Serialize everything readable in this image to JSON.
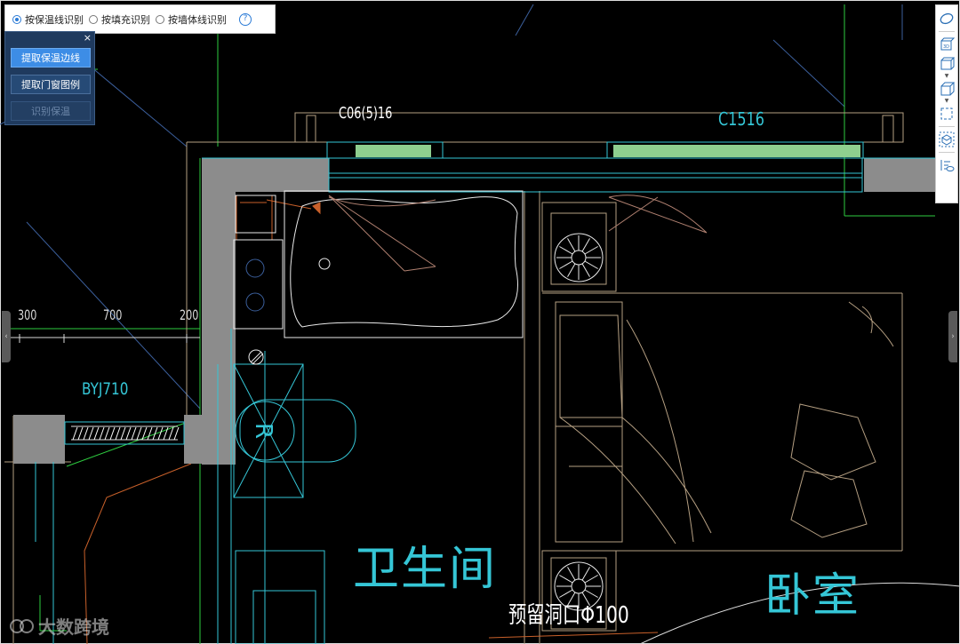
{
  "mode_bar": {
    "options": [
      {
        "label": "按保温线识别",
        "selected": true
      },
      {
        "label": "按填充识别",
        "selected": false
      },
      {
        "label": "按墙体线识别",
        "selected": false
      }
    ],
    "help_glyph": "?"
  },
  "panel": {
    "close_glyph": "×",
    "buttons": {
      "extract_boundary": "提取保温边线",
      "extract_legend": "提取门窗图例",
      "recognize": "识别保温"
    }
  },
  "drawing": {
    "window_tag_1": "C06(5)16",
    "window_tag_2": "C1516",
    "wall_tag": "BYJ710",
    "dim_1": "300",
    "dim_2": "700",
    "dim_3": "200",
    "room_bathroom": "卫生间",
    "room_bedroom": "卧室",
    "note_opening": "预留洞口Φ100",
    "letter_r": "R"
  },
  "side_tabs": {
    "left": "‹",
    "right": "›"
  },
  "watermark": {
    "text": "大数跨境"
  },
  "colors": {
    "canvas": "#000000",
    "wall_fill": "#8c8c8c",
    "cyan": "#35c6d6",
    "green": "#2ecc40",
    "window_green": "#8fcf8f",
    "tan": "#b59f82",
    "panel_bg": "#1f3a5e",
    "primary_btn": "#3d8de6"
  },
  "right_toolbar": {
    "icons": [
      "3d-orbit-icon",
      "3d-view-icon",
      "box-icon",
      "cube-icon",
      "dashed-select-icon",
      "layer-icon",
      "layer-visibility-icon"
    ]
  }
}
